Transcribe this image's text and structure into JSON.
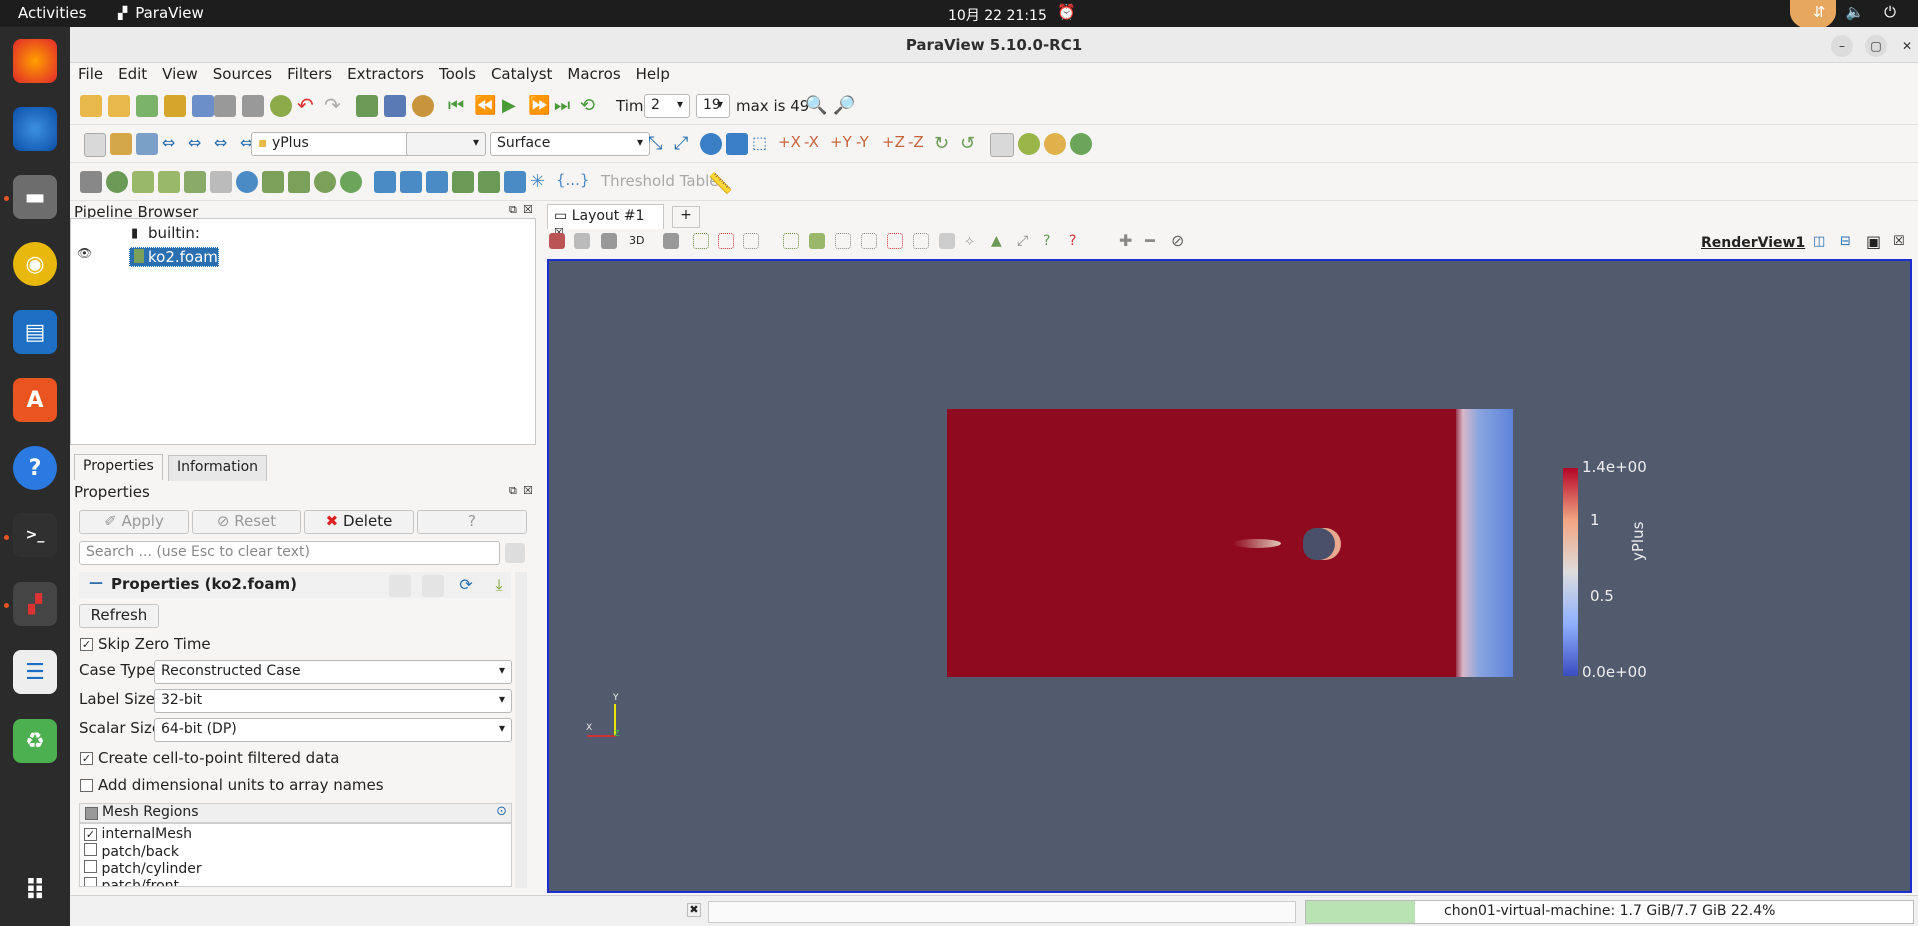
{
  "topbar": {
    "activities": "Activities",
    "app_name": "ParaView",
    "clock": "10月 22  21:15"
  },
  "window": {
    "title": "ParaView 5.10.0-RC1"
  },
  "menu": [
    "File",
    "Edit",
    "View",
    "Sources",
    "Filters",
    "Extractors",
    "Tools",
    "Catalyst",
    "Macros",
    "Help"
  ],
  "time": {
    "label": "Time:",
    "value": "2",
    "index": "19",
    "max": "max is 49"
  },
  "toolbar2": {
    "array": "yPlus",
    "component": "",
    "representation": "Surface"
  },
  "toolbar3": {
    "threshold_table": "Threshold Table"
  },
  "pipeline": {
    "title": "Pipeline Browser",
    "root": "builtin:",
    "item": "ko2.foam"
  },
  "props": {
    "tab_properties": "Properties",
    "tab_information": "Information",
    "title": "Properties",
    "apply": "Apply",
    "reset": "Reset",
    "delete": "Delete",
    "help": "?",
    "search_placeholder": "Search ... (use Esc to clear text)",
    "section": "Properties (ko2.foam)",
    "refresh": "Refresh",
    "skip_zero": "Skip Zero Time",
    "case_type_label": "Case Type",
    "case_type": "Reconstructed Case",
    "label_size_label": "Label Size",
    "label_size": "32-bit",
    "scalar_size_label": "Scalar Size",
    "scalar_size": "64-bit (DP)",
    "cell_to_point": "Create cell-to-point filtered data",
    "dim_units": "Add dimensional units to array names",
    "mesh_regions": "Mesh Regions",
    "regions": [
      {
        "name": "internalMesh",
        "checked": "✓"
      },
      {
        "name": "patch/back",
        "checked": ""
      },
      {
        "name": "patch/cylinder",
        "checked": ""
      },
      {
        "name": "patch/front",
        "checked": ""
      }
    ]
  },
  "layout": {
    "tab": "Layout #1",
    "add": "+",
    "view3d": "3D",
    "view_name": "RenderView1"
  },
  "colorbar": {
    "title": "yPlus",
    "max": "1.4e+00",
    "t1": "1",
    "t2": "0.5",
    "min": "0.0e+00"
  },
  "axes": {
    "y": "Y",
    "x": "X",
    "z": "Z"
  },
  "status": {
    "memory": "chon01-virtual-machine: 1.7 GiB/7.7 GiB 22.4%",
    "memory_fraction": 0.224
  },
  "colors": {
    "field": "#8f0a1f",
    "background": "#525a6e",
    "accent": "#1f2ecf"
  }
}
